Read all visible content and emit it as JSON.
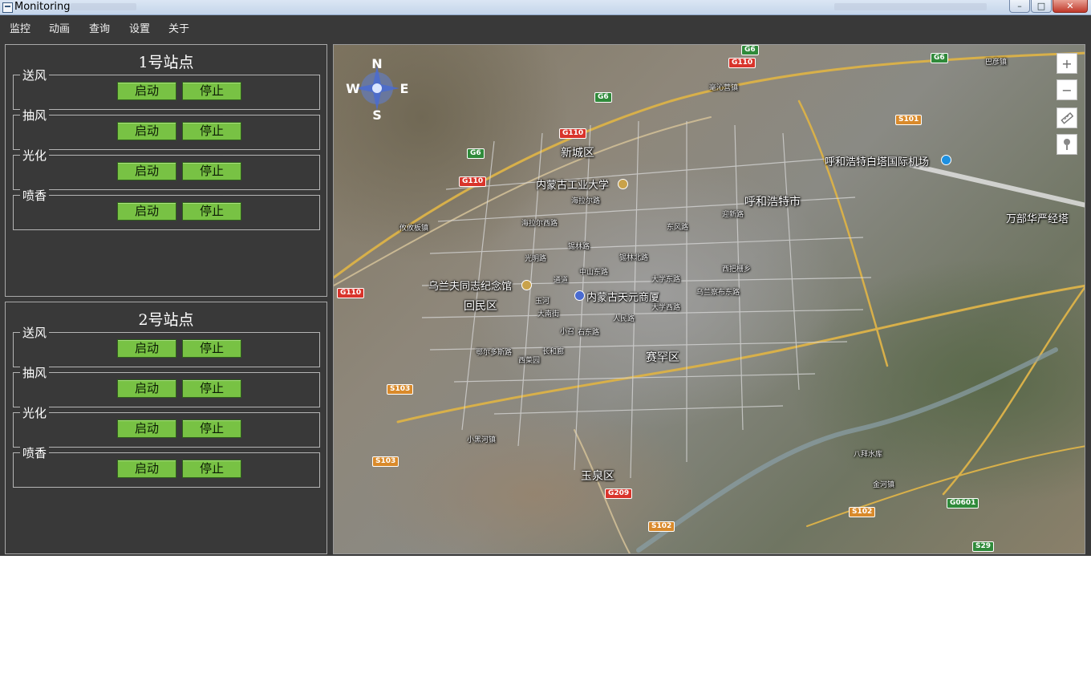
{
  "window": {
    "title": "Monitoring",
    "minimize_glyph": "–",
    "maximize_glyph": "□",
    "close_glyph": "✕"
  },
  "menu": [
    "监控",
    "动画",
    "查询",
    "设置",
    "关于"
  ],
  "stations": [
    {
      "title": "1号站点",
      "groups": [
        {
          "label": "送风",
          "start": "启动",
          "stop": "停止"
        },
        {
          "label": "抽风",
          "start": "启动",
          "stop": "停止"
        },
        {
          "label": "光化",
          "start": "启动",
          "stop": "停止"
        },
        {
          "label": "喷香",
          "start": "启动",
          "stop": "停止"
        }
      ]
    },
    {
      "title": "2号站点",
      "groups": [
        {
          "label": "送风",
          "start": "启动",
          "stop": "停止"
        },
        {
          "label": "抽风",
          "start": "启动",
          "stop": "停止"
        },
        {
          "label": "光化",
          "start": "启动",
          "stop": "停止"
        },
        {
          "label": "喷香",
          "start": "启动",
          "stop": "停止"
        }
      ]
    }
  ],
  "map": {
    "compass": {
      "n": "N",
      "s": "S",
      "e": "E",
      "w": "W"
    },
    "controls": {
      "zoom_in": "+",
      "zoom_out": "−",
      "ruler_icon": "ruler-icon",
      "pin_icon": "pin-icon"
    },
    "places": {
      "xincheng": "新城区",
      "neimenggu_univ": "内蒙古工业大学",
      "hohhot": "呼和浩特市",
      "airport": "呼和浩特白塔国际机场",
      "wanbu": "万部华严经塔",
      "ulanfu": "乌兰夫同志纪念馆",
      "huimin": "回民区",
      "tianyuan": "内蒙古天元商厦",
      "saihan": "赛罕区",
      "yuquan": "玉泉区"
    },
    "small_labels": {
      "haolai": "毫沁营镇",
      "bashen": "巴彦镇",
      "hailaer": "海拉尔路",
      "hailaerxi": "海拉尔西路",
      "yingbin": "迎新路",
      "dongfeng": "东风路",
      "xilinguole": "锡林路",
      "guangming": "光明路",
      "xilinbei": "锡林北路",
      "zhongshan": "中山东路",
      "tongdao": "通道",
      "daxuedong": "大学东路",
      "xibiedie": "西把栅乡",
      "wulanchabu": "乌兰察布东路",
      "yuquanhe": "玉河",
      "dananjie": "大南街",
      "renmin": "人民路",
      "daxuexi": "大学西路",
      "xiaozhao": "小召",
      "shidong": "石东路",
      "erdosi": "鄂尔多斯路",
      "changhe": "长和廊",
      "xicaiyuan": "西菜园",
      "xiaoheihe": "小黑河镇",
      "bazhai": "八拜水库",
      "jinhe": "金河镇",
      "yousuban": "攸攸板镇"
    },
    "shields": {
      "g6_top": "G6",
      "g110_top": "G110",
      "g6_right": "G6",
      "g6_a": "G6",
      "g110_b": "G110",
      "g6_b": "G6",
      "g110_c": "G110",
      "g110_d": "G110",
      "s101": "S101",
      "s103_a": "S103",
      "s103_b": "S103",
      "g209": "G209",
      "s102_a": "S102",
      "s102_b": "S102",
      "g0601": "G0601",
      "s29": "S29"
    }
  }
}
